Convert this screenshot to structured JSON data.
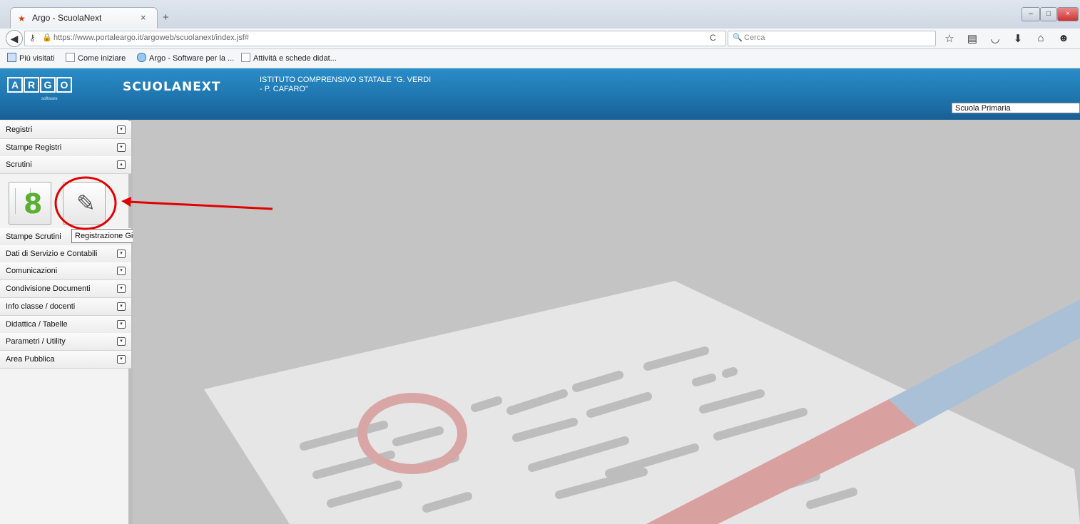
{
  "browser": {
    "tab_title": "Argo - ScuolaNext",
    "tab_close": "×",
    "new_tab": "+",
    "url": "https://www.portaleargo.it/argoweb/scuolanext/index.jsf#",
    "search_placeholder": "Cerca",
    "reload_glyph": "C",
    "toolbar_icons": [
      "star-icon",
      "clipboard-icon",
      "pocket-icon",
      "download-icon",
      "home-icon",
      "chat-icon"
    ],
    "bookmarks": [
      "Più visitati",
      "Come iniziare",
      "Argo - Software per la ...",
      "Attività e schede didat..."
    ]
  },
  "header": {
    "logo_letters": [
      "A",
      "R",
      "G",
      "O"
    ],
    "logo_sub": "software",
    "app_name": "SCUOLANEXT",
    "school_line1": "ISTITUTO COMPRENSIVO STATALE \"G. VERDI",
    "school_line2": "- P. CAFARO\"",
    "school_select": "Scuola Primaria"
  },
  "sidebar": {
    "menus": [
      {
        "label": "Registri",
        "state": "collapsed"
      },
      {
        "label": "Stampe Registri",
        "state": "collapsed"
      },
      {
        "label": "Scrutini",
        "state": "expanded"
      },
      {
        "label": "Stampe Scrutini",
        "state": "collapsed"
      },
      {
        "label": "Dati di Servizio e Contabili",
        "state": "collapsed"
      },
      {
        "label": "Comunicazioni",
        "state": "collapsed"
      },
      {
        "label": "Condivisione Documenti",
        "state": "collapsed"
      },
      {
        "label": "Info classe / docenti",
        "state": "collapsed"
      },
      {
        "label": "Didattica / Tabelle",
        "state": "collapsed"
      },
      {
        "label": "Parametri / Utility",
        "state": "collapsed"
      },
      {
        "label": "Area Pubblica",
        "state": "collapsed"
      }
    ],
    "scrutini_tiles": [
      {
        "icon": "grades-icon",
        "glyph": "8"
      },
      {
        "icon": "pencil-icon",
        "glyph": "✎"
      }
    ],
    "tooltip": "Registrazione Giudizi"
  },
  "colors": {
    "header_blue": "#1c6fa8",
    "annotation_red": "#e00000",
    "main_background": "#c4c4c4"
  }
}
